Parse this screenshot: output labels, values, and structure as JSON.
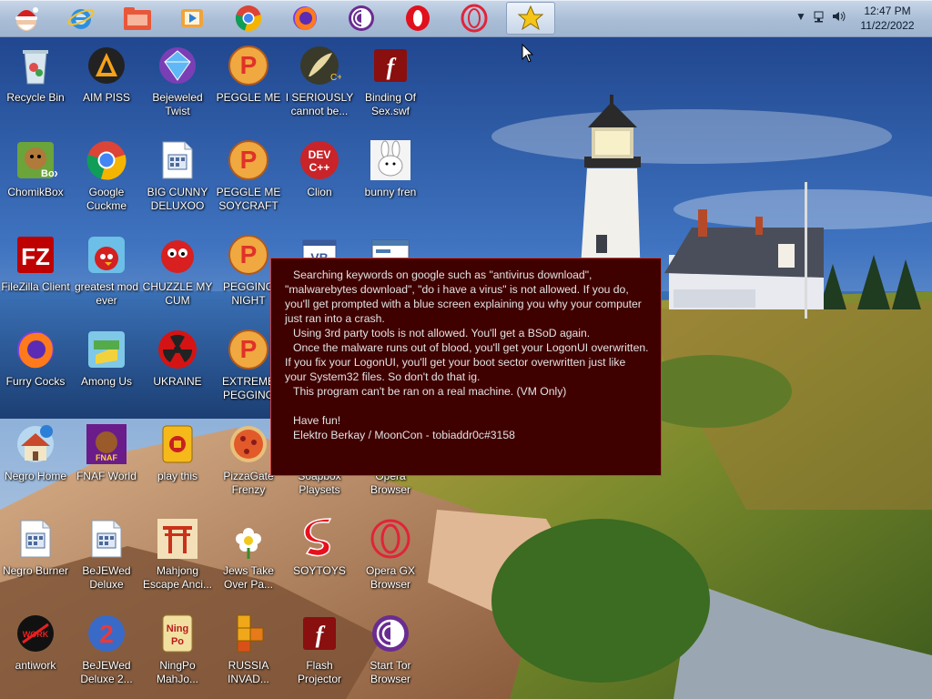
{
  "taskbar": {
    "pinned": [
      {
        "name": "santa",
        "icon": "santa-icon"
      },
      {
        "name": "internet-explorer",
        "icon": "internet-explorer-icon"
      },
      {
        "name": "file-explorer",
        "icon": "folder-icon"
      },
      {
        "name": "media-player",
        "icon": "media-player-icon"
      },
      {
        "name": "chrome",
        "icon": "chrome-icon"
      },
      {
        "name": "firefox",
        "icon": "firefox-icon"
      },
      {
        "name": "tor",
        "icon": "tor-icon"
      },
      {
        "name": "opera",
        "icon": "opera-icon"
      },
      {
        "name": "opera-gx",
        "icon": "opera-gx-icon"
      },
      {
        "name": "star-app",
        "icon": "star-icon"
      }
    ],
    "clock": {
      "time": "12:47 PM",
      "date": "11/22/2022"
    }
  },
  "desktop_icons": [
    {
      "label": "Recycle Bin",
      "icon": "recycle-bin-icon"
    },
    {
      "label": "AIM PISS",
      "icon": "aimp-icon"
    },
    {
      "label": "Bejeweled Twist",
      "icon": "bejeweled-icon"
    },
    {
      "label": "PEGGLE ME",
      "icon": "peggle-icon"
    },
    {
      "label": "I SERIOUSLY cannot be...",
      "icon": "feather-icon"
    },
    {
      "label": "Binding Of Sex.swf",
      "icon": "flash-icon"
    },
    {
      "label": "ChomikBox",
      "icon": "chomikbox-icon"
    },
    {
      "label": "Google Cuckme",
      "icon": "chrome-icon"
    },
    {
      "label": "BIG CUNNY DELUXOO",
      "icon": "document-icon"
    },
    {
      "label": "PEGGLE ME SOYCRAFT",
      "icon": "peggle-icon"
    },
    {
      "label": "Clion",
      "icon": "devcpp-icon"
    },
    {
      "label": "bunny fren",
      "icon": "bunny-icon"
    },
    {
      "label": "FileZilla Client",
      "icon": "filezilla-icon"
    },
    {
      "label": "greatest mod ever",
      "icon": "angry-birds-icon"
    },
    {
      "label": "CHUZZLE MY CUM",
      "icon": "chuzzle-icon"
    },
    {
      "label": "PEGGING NIGHT",
      "icon": "peggle-icon"
    },
    {
      "label": "",
      "icon": "vb-icon"
    },
    {
      "label": "",
      "icon": "window-icon"
    },
    {
      "label": "Furry Cocks",
      "icon": "firefox-icon"
    },
    {
      "label": "Among Us",
      "icon": "among-us-icon"
    },
    {
      "label": "UKRAINE",
      "icon": "radiation-icon"
    },
    {
      "label": "EXTREME PEGGING",
      "icon": "peggle-icon"
    },
    {
      "label": "Negro Home",
      "icon": "home-icon"
    },
    {
      "label": "FNAF World",
      "icon": "fnaf-icon"
    },
    {
      "label": "play this",
      "icon": "mahjong-tile-icon"
    },
    {
      "label": "PizzaGate Frenzy",
      "icon": "pizza-icon"
    },
    {
      "label": "Soapbox Playsets",
      "icon": "blank-icon"
    },
    {
      "label": "Opera Browser",
      "icon": "blank-icon"
    },
    {
      "label": "Negro Burner",
      "icon": "document-icon"
    },
    {
      "label": "BeJEWed Deluxe",
      "icon": "document-icon"
    },
    {
      "label": "Mahjong Escape Anci...",
      "icon": "torii-icon"
    },
    {
      "label": "Jews Take Over Pa...",
      "icon": "flower-icon"
    },
    {
      "label": "SOYTOYS",
      "icon": "soytoys-icon"
    },
    {
      "label": "Opera GX Browser",
      "icon": "opera-gx-icon"
    },
    {
      "label": "antiwork",
      "icon": "antiwork-icon"
    },
    {
      "label": "BeJEWed Deluxe 2...",
      "icon": "bejeweled2-icon"
    },
    {
      "label": "NingPo MahJo...",
      "icon": "ningpo-icon"
    },
    {
      "label": "RUSSIA INVAD...",
      "icon": "tetris-icon"
    },
    {
      "label": "Flash Projector",
      "icon": "flash-icon"
    },
    {
      "label": "Start Tor Browser",
      "icon": "tor-icon"
    }
  ],
  "message": {
    "paragraphs": [
      "Searching keywords on google such as \"antivirus download\", \"malwarebytes download\", \"do i have a virus\" is not allowed. If you do, you'll get prompted with a blue screen explaining you why your computer just ran into a crash.",
      "Using 3rd party tools is not allowed. You'll get a BSoD again.",
      "Once the malware runs out of blood, you'll get your LogonUI overwritten. If you fix your LogonUI, you'll get your boot sector overwritten just like your System32 files. So don't do that ig.",
      "This program can't be ran on a real machine. (VM Only)",
      "",
      "Have fun!",
      "Elektro Berkay / MoonCon - tobiaddr0c#3158"
    ]
  },
  "colors": {
    "message_bg": "#3f0000",
    "message_border": "#c84040",
    "message_text": "#e2e2e2",
    "sky_top": "#1c4a8c",
    "sea": "#2a5fa8"
  }
}
